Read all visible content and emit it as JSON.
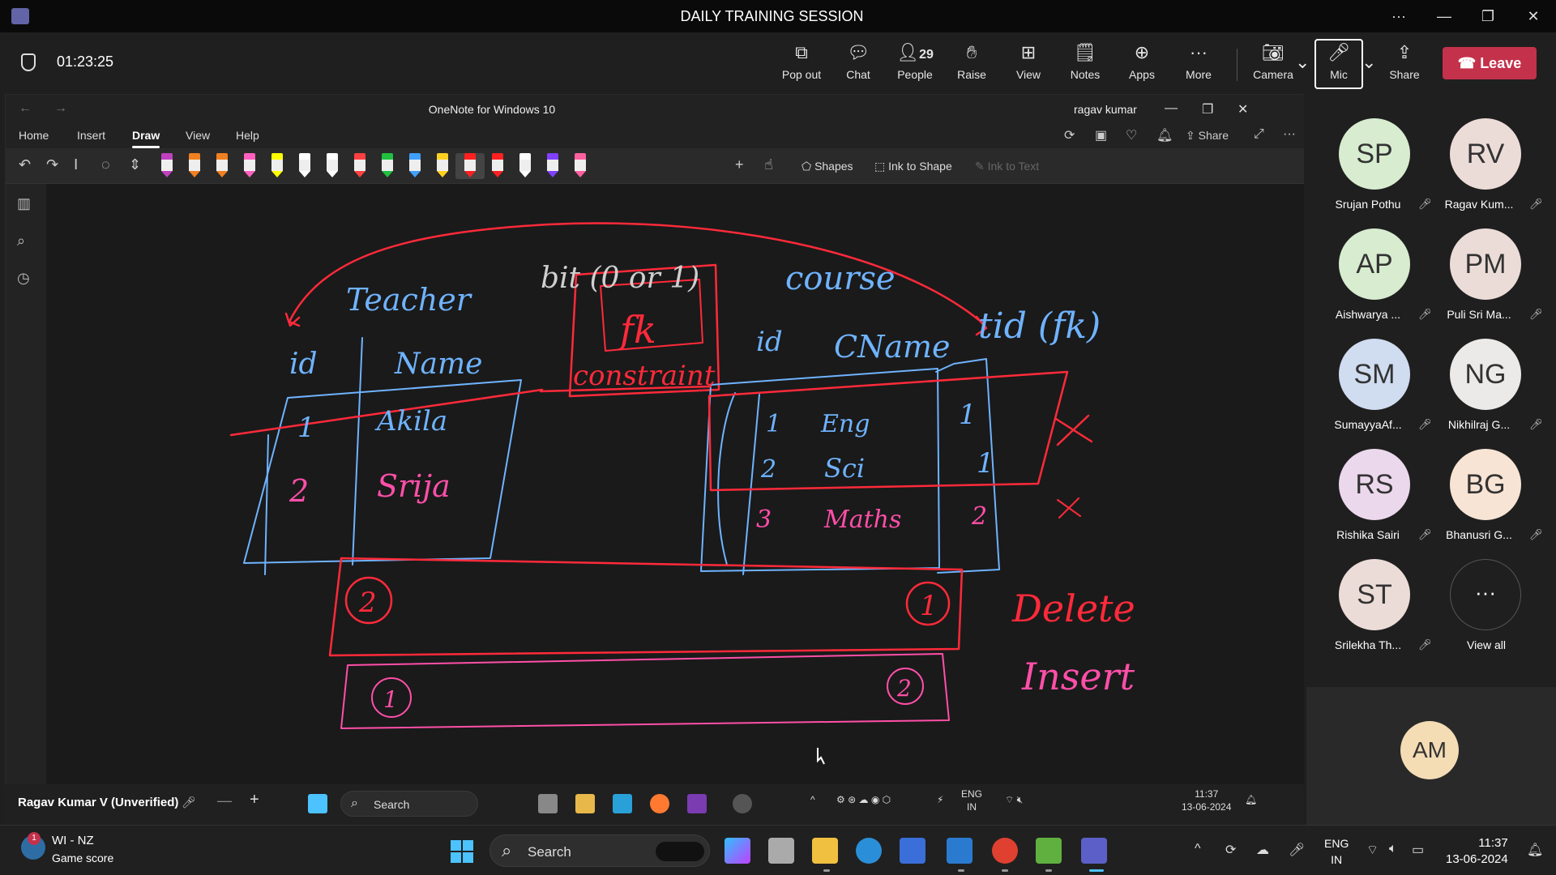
{
  "teams": {
    "title": "DAILY TRAINING SESSION",
    "timer": "01:23:25",
    "toolbar": [
      {
        "icon": "pop-out-icon",
        "label": "Pop out"
      },
      {
        "icon": "chat-icon",
        "label": "Chat"
      },
      {
        "icon": "people-icon",
        "label": "People",
        "count": "29"
      },
      {
        "icon": "raise-hand-icon",
        "label": "Raise"
      },
      {
        "icon": "view-icon",
        "label": "View"
      },
      {
        "icon": "notes-icon",
        "label": "Notes"
      },
      {
        "icon": "apps-icon",
        "label": "Apps"
      },
      {
        "icon": "more-icon",
        "label": "More"
      }
    ],
    "camera_label": "Camera",
    "mic_label": "Mic",
    "share_label": "Share",
    "leave_label": "Leave",
    "leave_color": "#c4314b"
  },
  "onenote": {
    "title": "OneNote for Windows 10",
    "user": "ragav kumar",
    "menu": [
      "Home",
      "Insert",
      "Draw",
      "View",
      "Help"
    ],
    "active_menu": "Draw",
    "share_label": "Share",
    "tools": {
      "shapes": "Shapes",
      "ink_to_shape": "Ink to Shape",
      "ink_to_text": "Ink to Text"
    },
    "pen_colors": [
      "#c040c0",
      "#f08020",
      "#f08020",
      "#ff60c0",
      "#ffff00",
      "#ffffff",
      "#ffffff",
      "#ff4040",
      "#20c040",
      "#40a0ff",
      "#ffd020",
      "#ff2020",
      "#ff2020",
      "#ffffff",
      "#8040ff",
      "#ff60a0"
    ],
    "ink": {
      "top_label": "bit (0 or 1)",
      "teacher": "Teacher",
      "course": "course",
      "fk": "fk",
      "constraint": "constraint",
      "tid_fk": "tid (fk)",
      "teacher_cols": [
        "id",
        "Name"
      ],
      "teacher_rows": [
        [
          "1",
          "Akila"
        ],
        [
          "2",
          "Srija"
        ]
      ],
      "course_cols": [
        "id",
        "CName",
        "tid"
      ],
      "course_rows": [
        [
          "1",
          "Eng",
          "1"
        ],
        [
          "2",
          "Sci",
          "1"
        ],
        [
          "3",
          "Maths",
          "2"
        ]
      ],
      "delete_box": [
        "2",
        "1"
      ],
      "insert_box": [
        "1",
        "2"
      ],
      "delete": "Delete",
      "insert": "Insert"
    }
  },
  "inner_taskbar": {
    "presenter": "Ragav Kumar V (Unverified)",
    "search": "Search",
    "lang": [
      "ENG",
      "IN"
    ],
    "time": "11:37",
    "date": "13-06-2024"
  },
  "participants": [
    {
      "initials": "SP",
      "name": "Srujan Pothu",
      "color": "#d8ecd0"
    },
    {
      "initials": "RV",
      "name": "Ragav Kum...",
      "color": "#ecdcd8"
    },
    {
      "initials": "AP",
      "name": "Aishwarya ...",
      "color": "#d8ecd0"
    },
    {
      "initials": "PM",
      "name": "Puli Sri Ma...",
      "color": "#ecdcd8"
    },
    {
      "initials": "SM",
      "name": "SumayyaAf...",
      "color": "#d0dcf0"
    },
    {
      "initials": "NG",
      "name": "Nikhilraj G...",
      "color": "#eceae8"
    },
    {
      "initials": "RS",
      "name": "Rishika Sairi",
      "color": "#ecd8ec"
    },
    {
      "initials": "BG",
      "name": "Bhanusri G...",
      "color": "#f8e4d4"
    },
    {
      "initials": "ST",
      "name": "Srilekha Th...",
      "color": "#ecdcd8"
    }
  ],
  "view_all_label": "View all",
  "self_initials": "AM",
  "self_color": "#f4dcb4",
  "taskbar": {
    "weather_title": "WI - NZ",
    "weather_sub": "Game score",
    "badge": "1",
    "search": "Search",
    "lang": [
      "ENG",
      "IN"
    ],
    "time": "11:37",
    "date": "13-06-2024"
  }
}
